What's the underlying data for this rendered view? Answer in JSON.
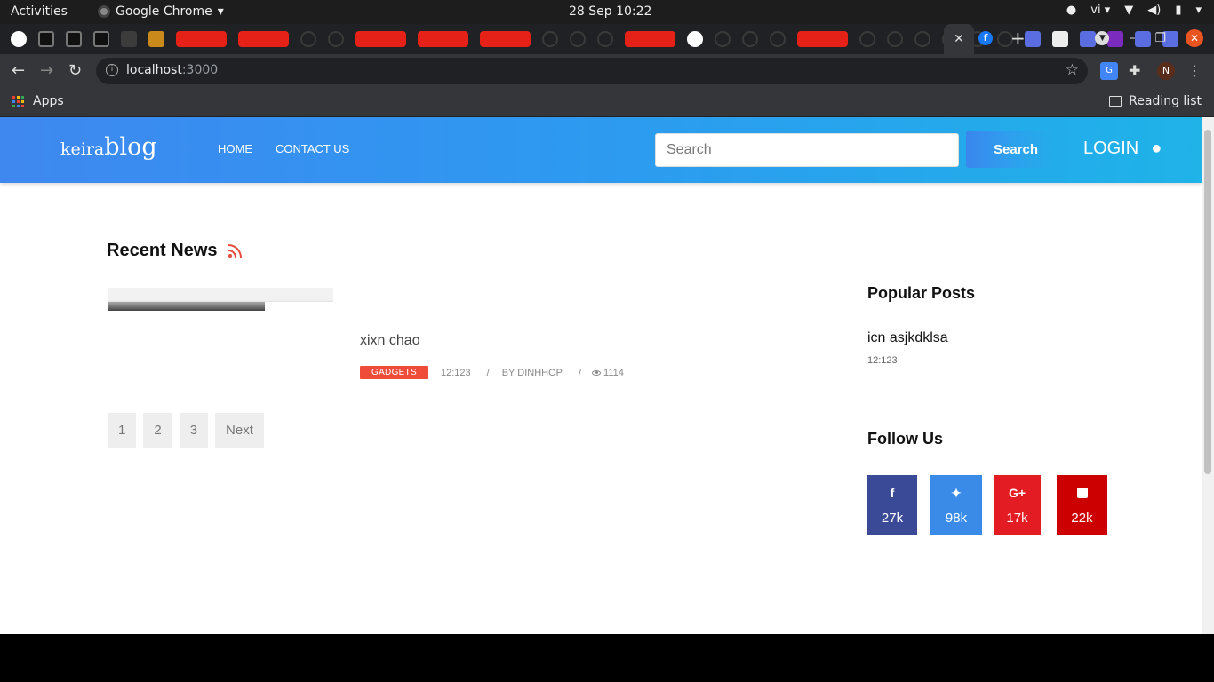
{
  "os": {
    "activities": "Activities",
    "app_name": "Google Chrome",
    "clock": "28 Sep  10:22",
    "lang": "vi"
  },
  "browser": {
    "url_host": "localhost",
    "url_port": ":3000",
    "bookmarks_apps": "Apps",
    "reading_list": "Reading list",
    "profile_initial": "N"
  },
  "site": {
    "logo_prefix": "keira",
    "logo_main": "blog",
    "nav": [
      "HOME",
      "CONTACT US"
    ],
    "search_placeholder": "Search",
    "search_button": "Search",
    "login": "LOGIN"
  },
  "recent_news": {
    "title": "Recent News",
    "post": {
      "title": "xixn chao",
      "category": "GADGETS",
      "time": "12:123",
      "author": "BY DINHHOP",
      "views": "1114"
    },
    "pagination": [
      "1",
      "2",
      "3",
      "Next"
    ]
  },
  "sidebar": {
    "popular_title": "Popular Posts",
    "popular_item_title": "icn asjkdklsa",
    "popular_item_time": "12:123",
    "follow_title": "Follow Us",
    "social": [
      {
        "network": "facebook",
        "count": "27k",
        "color": "#3b4a96"
      },
      {
        "network": "twitter",
        "count": "98k",
        "color": "#3a8be8"
      },
      {
        "network": "google-plus",
        "count": "17k",
        "color": "#e31b23"
      },
      {
        "network": "youtube",
        "count": "22k",
        "color": "#cc0000"
      }
    ]
  }
}
